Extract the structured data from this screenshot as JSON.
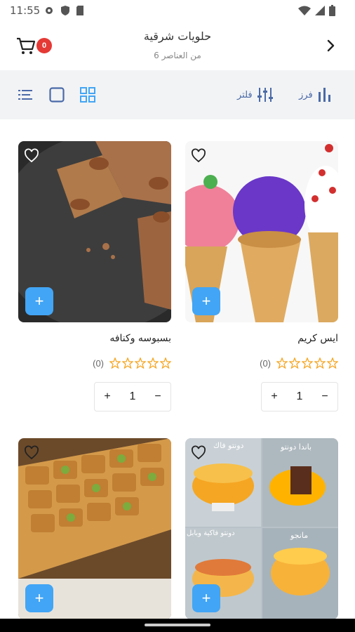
{
  "status": {
    "time": "11:55"
  },
  "header": {
    "title": "حلويات شرقية",
    "subtitle": "6 من العناصر",
    "cart_count": "0"
  },
  "toolbar": {
    "sort_label": "فرز",
    "filter_label": "فلتر"
  },
  "products": [
    {
      "name": "ايس كريم",
      "rating_count": "(0)",
      "quantity": "1",
      "image": "ice-cream-cones"
    },
    {
      "name": "بسبوسه وكنافه",
      "rating_count": "(0)",
      "quantity": "1",
      "image": "basbousa"
    },
    {
      "name": "",
      "image": "cakes-collage",
      "overlay_texts": [
        "دونتو فاك",
        "باندا دونتو",
        "دونتو فاكية وبابل",
        "مانجو"
      ]
    },
    {
      "name": "",
      "image": "baklava"
    }
  ],
  "colors": {
    "accent": "#42a5f5",
    "badge": "#e53935",
    "toolbar_bg": "#f2f3f5",
    "toolbar_text": "#4a6aa8"
  }
}
